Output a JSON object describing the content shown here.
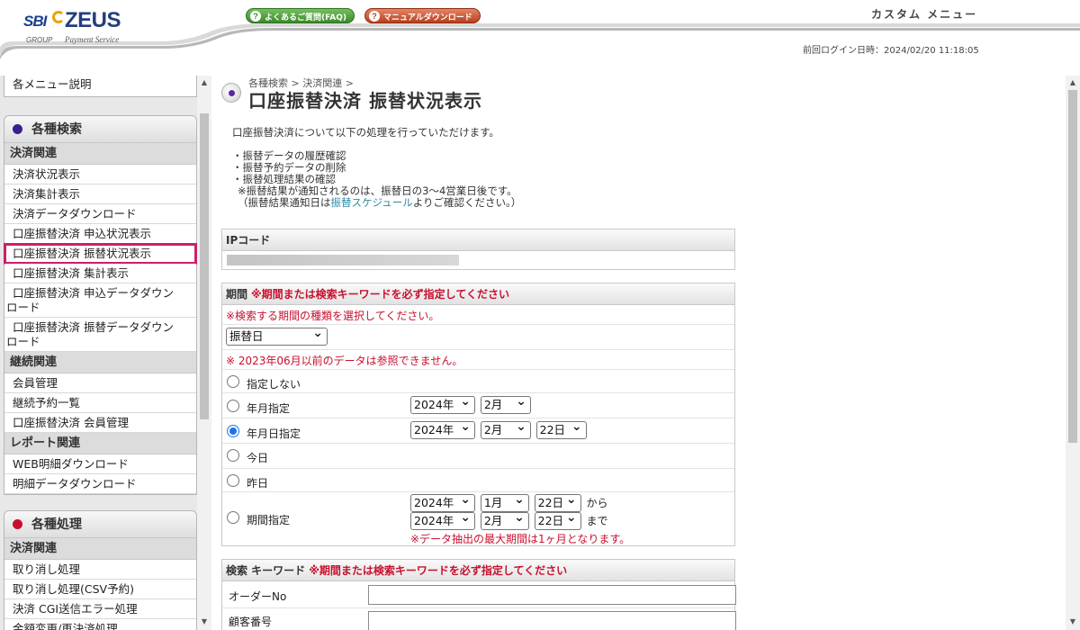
{
  "header": {
    "logo_sbi": "SBI",
    "logo_zeus": "ZEUS",
    "logo_group": "GROUP",
    "logo_payment_service": "Payment Service",
    "faq_button": "よくあるご質問(FAQ)",
    "manual_button": "マニュアルダウンロード",
    "custom_menu": "カスタム メニュー",
    "last_login": "前回ログイン日時：2024/02/20 11:18:05"
  },
  "sidebar": {
    "top_item": "各メニュー説明",
    "search_panel": {
      "title": "各種検索",
      "dot_color": "#3a1f8f",
      "categories": [
        {
          "name": "決済関連",
          "items": [
            "決済状況表示",
            "決済集計表示",
            "決済データダウンロード",
            "口座振替決済 申込状況表示",
            "口座振替決済 振替状況表示",
            "口座振替決済 集計表示",
            "口座振替決済 申込データダウン",
            "口座振替決済 振替データダウン"
          ],
          "items_line2": [
            "",
            "",
            "",
            "",
            "",
            "",
            "ロード",
            "ロード"
          ]
        },
        {
          "name": "継続関連",
          "items": [
            "会員管理",
            "継続予約一覧",
            "口座振替決済 会員管理"
          ]
        },
        {
          "name": "レポート関連",
          "items": [
            "WEB明細ダウンロード",
            "明細データダウンロード"
          ]
        }
      ]
    },
    "process_panel": {
      "title": "各種処理",
      "dot_color": "#c8102e",
      "categories": [
        {
          "name": "決済関連",
          "items": [
            "取り消し処理",
            "取り消し処理(CSV予約)",
            "決済 CGI送信エラー処理",
            "金額変更/再決済処理"
          ]
        }
      ]
    },
    "active_item": "口座振替決済 振替状況表示"
  },
  "main": {
    "breadcrumb": "各種検索 > 決済関連 >",
    "title": "口座振替決済 振替状況表示",
    "intro": {
      "line1": "口座振替決済について以下の処理を行っていただけます。",
      "bullet1": "・振替データの履歴確認",
      "bullet2": "・振替予約データの削除",
      "bullet3": "・振替処理結果の確認",
      "note1": "※振替結果が通知されるのは、振替日の3～4営業日後です。",
      "note2_prefix": "（振替結果通知日は",
      "note2_link": "振替スケジュール",
      "note2_suffix": "よりご確認ください。）"
    },
    "ip_code": {
      "label": "IPコード"
    },
    "period": {
      "label": "期間",
      "required_note": "※期間または検索キーワードを必ず指定してください",
      "select_prompt": "※検索する期間の種類を選択してください。",
      "period_type": "振替日",
      "data_limit_note": "※ 2023年06月以前のデータは参照できません。",
      "options": {
        "none": "指定しない",
        "year_month": "年月指定",
        "year_month_day": "年月日指定",
        "today": "今日",
        "yesterday": "昨日",
        "range": "期間指定"
      },
      "selected_option": "年月日指定",
      "ym_year": "2024年",
      "ym_month": "2月",
      "ymd_year": "2024年",
      "ymd_month": "2月",
      "ymd_day": "22日",
      "range_from_year": "2024年",
      "range_from_month": "1月",
      "range_from_day": "22日",
      "range_from_suffix": "から",
      "range_to_year": "2024年",
      "range_to_month": "2月",
      "range_to_day": "22日",
      "range_to_suffix": "まで",
      "max_period_note": "※データ抽出の最大期間は1ヶ月となります。"
    },
    "keyword": {
      "label": "検索 キーワード",
      "required_note": "※期間または検索キーワードを必ず指定してください",
      "order_no_label": "オーダーNo",
      "order_no_value": "",
      "customer_no_label": "顧客番号",
      "customer_no_value": ""
    }
  }
}
